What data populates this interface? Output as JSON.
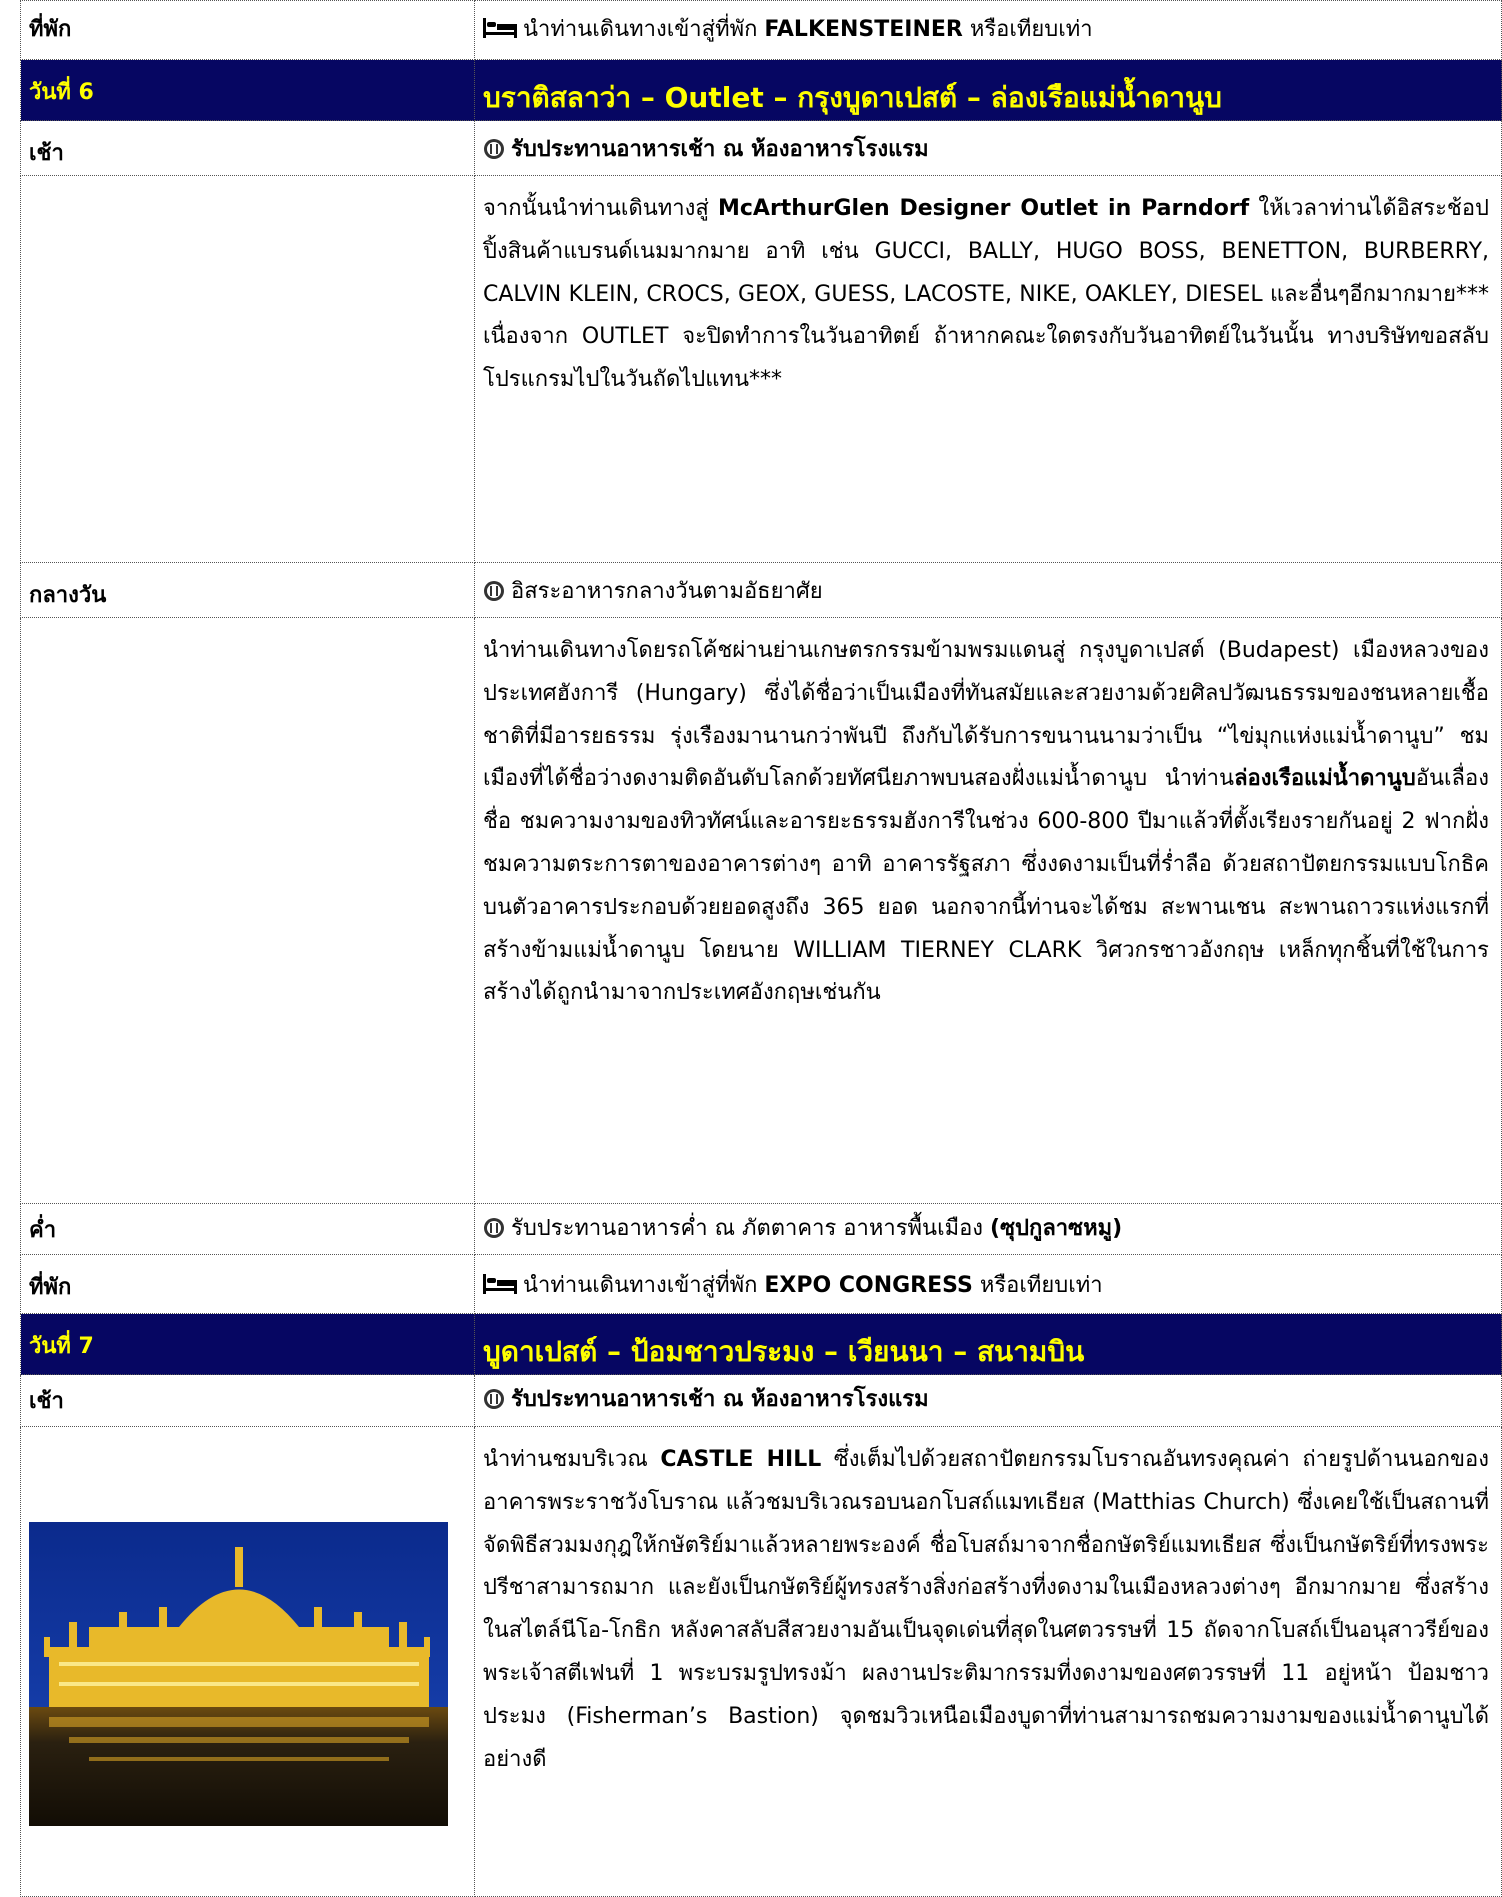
{
  "rows": {
    "r1": {
      "label": "ที่พัก",
      "pre": "นำท่านเดินทางเข้าสู่ที่พัก ",
      "bold": "FALKENSTEINER",
      "post": " หรือเทียบเท่า"
    },
    "day6": {
      "label": "วันที่ 6",
      "title": "บราติสลาว่า – Outlet – กรุงบูดาเปสต์ – ล่องเรือแม่น้ำดานูบ"
    },
    "r3": {
      "label": "เช้า",
      "text": "รับประทานอาหารเช้า ณ ห้องอาหารโรงแรม"
    },
    "r4": {
      "pre": "จากนั้นนำท่านเดินทางสู่ ",
      "bold": "McArthurGlen Designer Outlet in Parndorf",
      "post": " ให้เวลาท่านได้อิสระช้อปปิ้งสินค้าแบรนด์เนมมากมาย อาทิ เช่น GUCCI, BALLY, HUGO BOSS, BENETTON, BURBERRY, CALVIN KLEIN, CROCS, GEOX, GUESS, LACOSTE, NIKE, OAKLEY, DIESEL และอื่นๆอีกมากมาย*** เนื่องจาก OUTLET จะปิดทำการในวันอาทิตย์ ถ้าหากคณะใดตรงกับวันอาทิตย์ในวันนั้น ทางบริษัทขอสลับโปรแกรมไปในวันถัดไปแทน***"
    },
    "r5": {
      "label": "กลางวัน",
      "text": "อิสระอาหารกลางวันตามอัธยาศัย"
    },
    "r6": {
      "pre": "นำท่านเดินทางโดยรถโค้ชผ่านย่านเกษตรกรรมข้ามพรมแดนสู่ กรุงบูดาเปสต์ (Budapest) เมืองหลวงของ ประเทศฮังการี (Hungary) ซึ่งได้ชื่อว่าเป็นเมืองที่ทันสมัยและสวยงามด้วยศิลปวัฒนธรรมของชนหลายเชื้อชาติที่มีอารยธรรม รุ่งเรืองมานานกว่าพันปี ถึงกับได้รับการขนานนามว่าเป็น “ไข่มุกแห่งแม่น้ำดานูบ” ชมเมืองที่ได้ชื่อว่างดงามติดอันดับโลกด้วยทัศนียภาพบนสองฝั่งแม่น้ำดานูบ นำท่าน",
      "bold": "ล่องเรือแม่น้ำดานูบ",
      "post": "อันเลื่องชื่อ ชมความงามของทิวทัศน์และอารยะธรรมฮังการีในช่วง 600-800 ปีมาแล้วที่ตั้งเรียงรายกันอยู่ 2 ฟากฝั่ง ชมความตระการตาของอาคารต่างๆ อาทิ อาคารรัฐสภา ซึ่งงดงามเป็นที่ร่ำลือ ด้วยสถาปัตยกรรมแบบโกธิค บนตัวอาคารประกอบด้วยยอดสูงถึง 365 ยอด นอกจากนี้ท่านจะได้ชม สะพานเชน สะพานถาวรแห่งแรกที่สร้างข้ามแม่น้ำดานูบ โดยนาย WILLIAM TIERNEY CLARK วิศวกรชาวอังกฤษ เหล็กทุกชิ้นที่ใช้ในการสร้างได้ถูกนำมาจากประเทศอังกฤษเช่นกัน"
    },
    "r7": {
      "label": "ค่ำ",
      "pre": "รับประทานอาหารค่ำ ณ ภัตตาคาร อาหารพื้นเมือง ",
      "bold": "(ซุปกูลาซหมู)"
    },
    "r8": {
      "label": "ที่พัก",
      "pre": "นำท่านเดินทางเข้าสู่ที่พัก ",
      "bold": "EXPO CONGRESS",
      "post": " หรือเทียบเท่า"
    },
    "day7": {
      "label": "วันที่ 7",
      "title": "บูดาเปสต์ – ป้อมชาวประมง – เวียนนา – สนามบิน"
    },
    "r10": {
      "label": "เช้า",
      "text": "รับประทานอาหารเช้า ณ ห้องอาหารโรงแรม"
    },
    "r11": {
      "pre": "นำท่านชมบริเวณ ",
      "bold": "CASTLE HILL",
      "post": " ซึ่งเต็มไปด้วยสถาปัตยกรรมโบราณอันทรงคุณค่า ถ่ายรูปด้านนอกของอาคารพระราชวังโบราณ แล้วชมบริเวณรอบนอกโบสถ์แมทเธียส (Matthias Church) ซึ่งเคยใช้เป็นสถานที่จัดพิธีสวมมงกุฎให้กษัตริย์มาแล้วหลายพระองค์ ชื่อโบสถ์มาจากชื่อกษัตริย์แมทเธียส ซึ่งเป็นกษัตริย์ที่ทรงพระปรีชาสามารถมาก และยังเป็นกษัตริย์ผู้ทรงสร้างสิ่งก่อสร้างที่งดงามในเมืองหลวงต่างๆ อีกมากมาย ซึ่งสร้างในสไตล์นีโอ-โกธิก หลังคาสลับสีสวยงามอันเป็นจุดเด่นที่สุดในศตวรรษที่ 15 ถัดจากโบสถ์เป็นอนุสาวรีย์ของพระเจ้าสตีเฟนที่ 1 พระบรมรูปทรงม้า ผลงานประติมากรรมที่งดงามของศตวรรษที่ 11 อยู่หน้า ป้อมชาวประมง (Fisherman’s Bastion) จุดชมวิวเหนือเมืองบูดาที่ท่านสามารถชมความงามของแม่น้ำดานูบได้อย่างดี"
    }
  },
  "colors": {
    "band_bg": "#060662",
    "band_text": "#ffff00"
  },
  "icons": [
    "bed-icon",
    "meal-icon"
  ]
}
